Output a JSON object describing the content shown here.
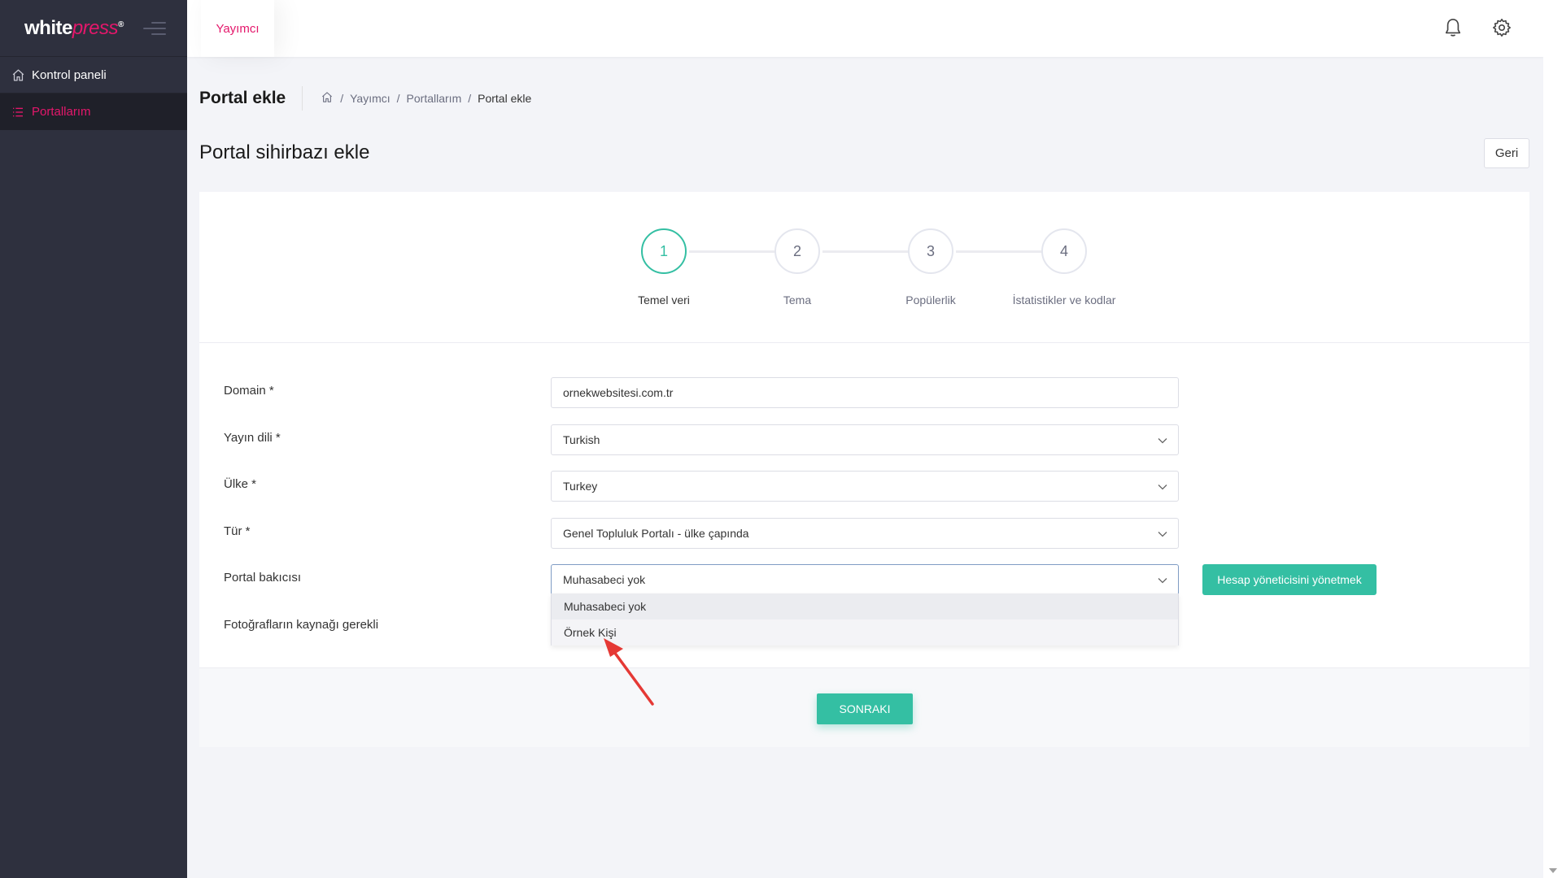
{
  "brand": {
    "name_white": "white",
    "name_press": "press",
    "registered": "®"
  },
  "sidebar": {
    "items": [
      {
        "label": "Kontrol paneli",
        "icon": "home-icon",
        "active": false
      },
      {
        "label": "Portallarım",
        "icon": "list-icon",
        "active": true
      }
    ]
  },
  "topbar": {
    "tab": "Yayımcı",
    "icons": [
      "bell-icon",
      "gear-icon"
    ]
  },
  "page": {
    "title": "Portal ekle",
    "breadcrumb": [
      "Yayımcı",
      "Portallarım",
      "Portal ekle"
    ],
    "wizard_title": "Portal sihirbazı ekle",
    "back_label": "Geri"
  },
  "wizard": {
    "steps": [
      {
        "number": "1",
        "label": "Temel veri",
        "active": true
      },
      {
        "number": "2",
        "label": "Tema",
        "active": false
      },
      {
        "number": "3",
        "label": "Popülerlik",
        "active": false
      },
      {
        "number": "4",
        "label": "İstatistikler ve kodlar",
        "active": false
      }
    ]
  },
  "form": {
    "domain": {
      "label": "Domain *",
      "value": "ornekwebsitesi.com.tr"
    },
    "language": {
      "label": "Yayın dili *",
      "value": "Turkish"
    },
    "country": {
      "label": "Ülke *",
      "value": "Turkey"
    },
    "type": {
      "label": "Tür *",
      "value": "Genel Topluluk Portalı - ülke çapında"
    },
    "keeper": {
      "label": "Portal bakıcısı",
      "value": "Muhasabeci yok",
      "options": [
        "Muhasabeci yok",
        "Örnek Kişi"
      ],
      "manage_button": "Hesap yöneticisini yönetmek"
    },
    "photo_source": {
      "label": "Fotoğrafların kaynağı gerekli"
    }
  },
  "actions": {
    "next_label": "SONRAKI"
  },
  "colors": {
    "accent_pink": "#e4176b",
    "accent_green": "#34bfa3",
    "sidebar_bg": "#2e303e",
    "annotation_red": "#e53935"
  }
}
